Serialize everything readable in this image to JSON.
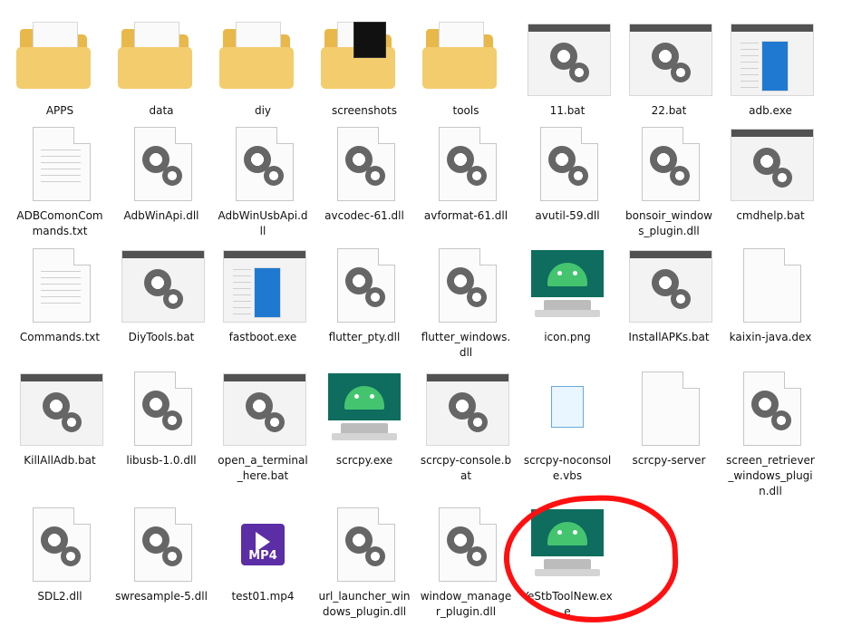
{
  "files": [
    {
      "name": "APPS",
      "type": "folder"
    },
    {
      "name": "data",
      "type": "folder"
    },
    {
      "name": "diy",
      "type": "folder"
    },
    {
      "name": "screenshots",
      "type": "folder-image"
    },
    {
      "name": "tools",
      "type": "folder"
    },
    {
      "name": "11.bat",
      "type": "bat"
    },
    {
      "name": "22.bat",
      "type": "bat"
    },
    {
      "name": "adb.exe",
      "type": "exe"
    },
    {
      "name": "ADBComonCommands.txt",
      "type": "txt"
    },
    {
      "name": "AdbWinApi.dll",
      "type": "dll"
    },
    {
      "name": "AdbWinUsbApi.dll",
      "type": "dll"
    },
    {
      "name": "avcodec-61.dll",
      "type": "dll"
    },
    {
      "name": "avformat-61.dll",
      "type": "dll"
    },
    {
      "name": "avutil-59.dll",
      "type": "dll"
    },
    {
      "name": "bonsoir_windows_plugin.dll",
      "type": "dll"
    },
    {
      "name": "cmdhelp.bat",
      "type": "bat"
    },
    {
      "name": "Commands.txt",
      "type": "txt"
    },
    {
      "name": "DiyTools.bat",
      "type": "bat"
    },
    {
      "name": "fastboot.exe",
      "type": "exe"
    },
    {
      "name": "flutter_pty.dll",
      "type": "dll"
    },
    {
      "name": "flutter_windows.dll",
      "type": "dll"
    },
    {
      "name": "icon.png",
      "type": "android"
    },
    {
      "name": "InstallAPKs.bat",
      "type": "bat"
    },
    {
      "name": "kaixin-java.dex",
      "type": "blank"
    },
    {
      "name": "KillAllAdb.bat",
      "type": "bat"
    },
    {
      "name": "libusb-1.0.dll",
      "type": "dll"
    },
    {
      "name": "open_a_terminal_here.bat",
      "type": "bat"
    },
    {
      "name": "scrcpy.exe",
      "type": "android"
    },
    {
      "name": "scrcpy-console.bat",
      "type": "bat"
    },
    {
      "name": "scrcpy-noconsole.vbs",
      "type": "vbs"
    },
    {
      "name": "scrcpy-server",
      "type": "blank"
    },
    {
      "name": "screen_retriever_windows_plugin.dll",
      "type": "dll"
    },
    {
      "name": "SDL2.dll",
      "type": "dll"
    },
    {
      "name": "swresample-5.dll",
      "type": "dll"
    },
    {
      "name": "test01.mp4",
      "type": "mp4"
    },
    {
      "name": "url_launcher_windows_plugin.dll",
      "type": "dll"
    },
    {
      "name": "window_manager_plugin.dll",
      "type": "dll"
    },
    {
      "name": "YeStbToolNew.exe",
      "type": "android"
    }
  ],
  "mp4_label": "MP4",
  "colors": {
    "folder": "#f3cc6d",
    "android_screen": "#0e6d5e",
    "android_bot": "#45c470",
    "highlight": "#ff1010"
  }
}
